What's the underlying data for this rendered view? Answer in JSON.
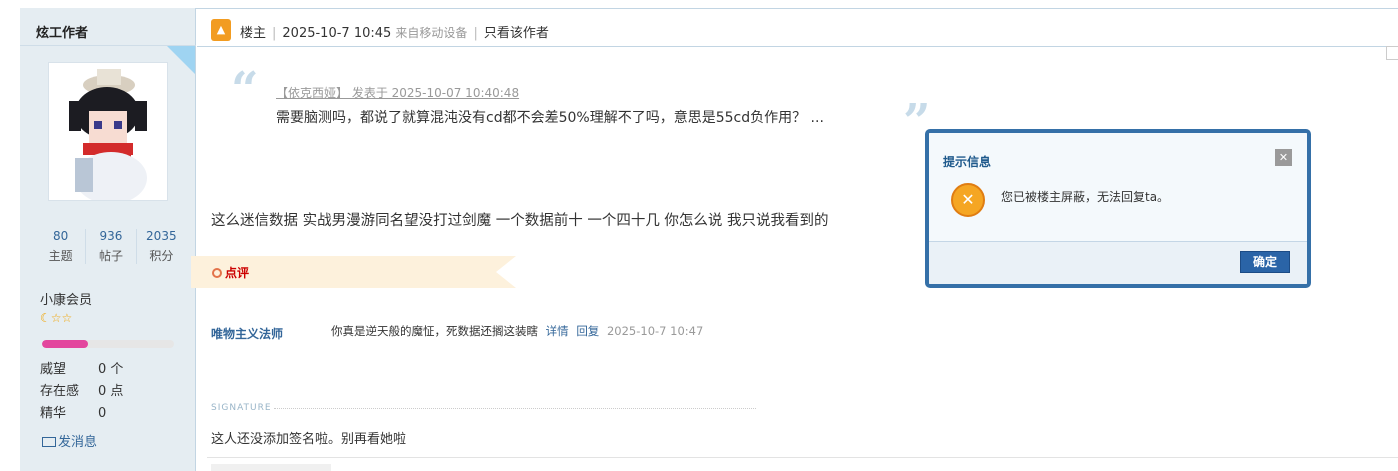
{
  "author": {
    "name": "炫工作者",
    "stats": [
      {
        "value": "80",
        "label": "主题"
      },
      {
        "value": "936",
        "label": "帖子"
      },
      {
        "value": "2035",
        "label": "积分"
      }
    ],
    "group": "小康会员",
    "level_progress": 0.35,
    "info": [
      {
        "label": "威望",
        "value": "0 个"
      },
      {
        "label": "存在感",
        "value": "0 点"
      },
      {
        "label": "精华",
        "value": "0"
      }
    ],
    "send_message": "发消息"
  },
  "post_header": {
    "floor": "楼主",
    "time": "2025-10-7 10:45",
    "device": "来自移动设备",
    "only_author": "只看该作者"
  },
  "quote": {
    "meta": "【依克西娅】 发表于 2025-10-07 10:40:48",
    "text": "需要脑测吗，都说了就算混沌没有cd都不会差50%理解不了吗，意思是55cd负作用？ ..."
  },
  "post_body": "这么迷信数据 实战男漫游同名望没打过剑魔 一个数据前十 一个四十几 你怎么说 我只说我看到的",
  "comments": {
    "label": "点评",
    "items": [
      {
        "user": "唯物主义法师",
        "text": "你真是逆天般的魔怔，死数据还搁这装瞎",
        "detail": "详情",
        "reply": "回复",
        "time": "2025-10-7 10:47"
      }
    ]
  },
  "signature": {
    "label": "SIGNATURE",
    "text": "这人还没添加签名啦。别再看她啦"
  },
  "dialog": {
    "title": "提示信息",
    "message": "您已被楼主屏蔽，无法回复ta。",
    "ok": "确定"
  }
}
